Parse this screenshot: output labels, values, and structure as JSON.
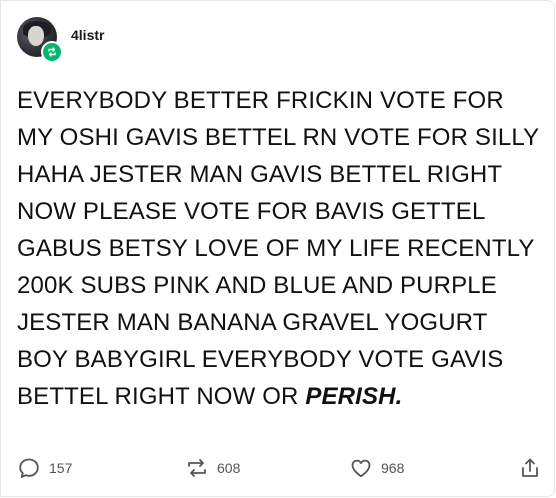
{
  "author": {
    "username": "4listr",
    "avatar_icon": "avatar-photo",
    "badge_icon": "reblog-badge-icon",
    "badge_color": "#00b86b"
  },
  "post": {
    "text": "EVERYBODY BETTER FRICKIN VOTE FOR MY OSHI GAVIS BETTEL RN VOTE FOR SILLY HAHA JESTER MAN GAVIS BETTEL RIGHT NOW PLEASE VOTE FOR BAVIS GETTEL GABUS BETSY LOVE OF MY LIFE RECENTLY 200K SUBS PINK AND BLUE AND PURPLE JESTER MAN BANANA GRAVEL YOGURT BOY BABYGIRL EVERYBODY VOTE GAVIS BETTEL RIGHT NOW OR ",
    "emphasis": "PERISH."
  },
  "actions": {
    "replies": {
      "icon": "comment-icon",
      "count": "157"
    },
    "reblogs": {
      "icon": "reblog-icon",
      "count": "608"
    },
    "likes": {
      "icon": "heart-icon",
      "count": "968"
    },
    "share": {
      "icon": "share-icon"
    }
  }
}
